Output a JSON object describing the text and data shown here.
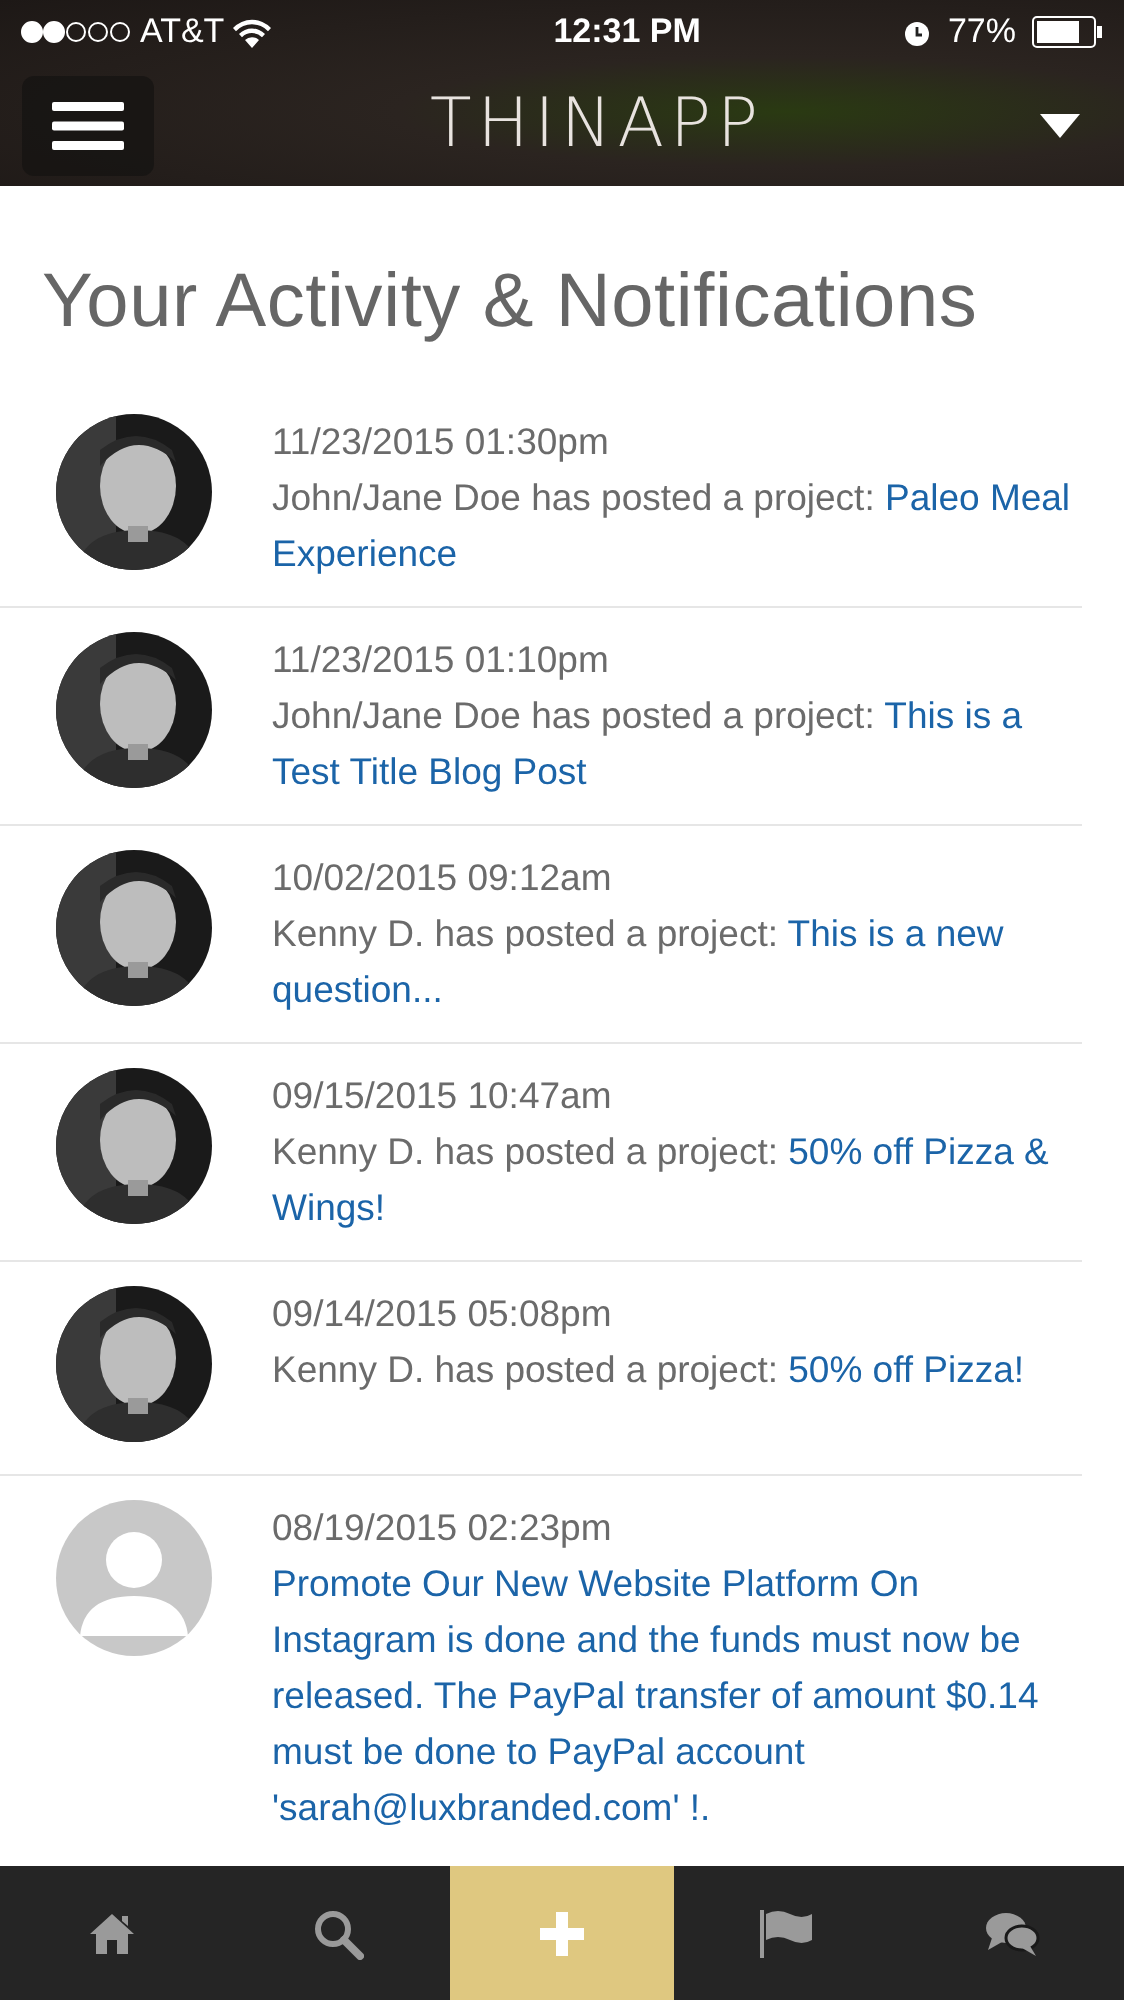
{
  "status_bar": {
    "carrier": "AT&T",
    "time": "12:31 PM",
    "battery": "77%"
  },
  "header": {
    "logo": "THINAPP"
  },
  "page_title": "Your Activity & Notifications",
  "notifications": [
    {
      "date": "11/23/2015 01:30pm",
      "text": "John/Jane Doe has posted a project: ",
      "link": "Paleo Meal Experience"
    },
    {
      "date": "11/23/2015 01:10pm",
      "text": "John/Jane Doe has posted a project: ",
      "link": "This is a Test Title Blog Post"
    },
    {
      "date": "10/02/2015 09:12am",
      "text": "Kenny D. has posted a project: ",
      "link": "This is a new question..."
    },
    {
      "date": "09/15/2015 10:47am",
      "text": "Kenny D. has posted a project: ",
      "link": "50% off Pizza & Wings!"
    },
    {
      "date": "09/14/2015 05:08pm",
      "text": "Kenny D. has posted a project: ",
      "link": "50% off Pizza!"
    },
    {
      "kind": "placeholder",
      "date": "08/19/2015 02:23pm",
      "link": "Promote Our New Website Platform On Instagram is done and the funds must now be released. The PayPal transfer of amount $0.14 must be done to PayPal account 'sarah@luxbranded.com' !."
    }
  ],
  "tab_bar": [
    {
      "kind": "home",
      "selected": false
    },
    {
      "kind": "search",
      "selected": false
    },
    {
      "kind": "plus",
      "selected": true
    },
    {
      "kind": "flag",
      "selected": false
    },
    {
      "kind": "chat",
      "selected": false
    }
  ]
}
